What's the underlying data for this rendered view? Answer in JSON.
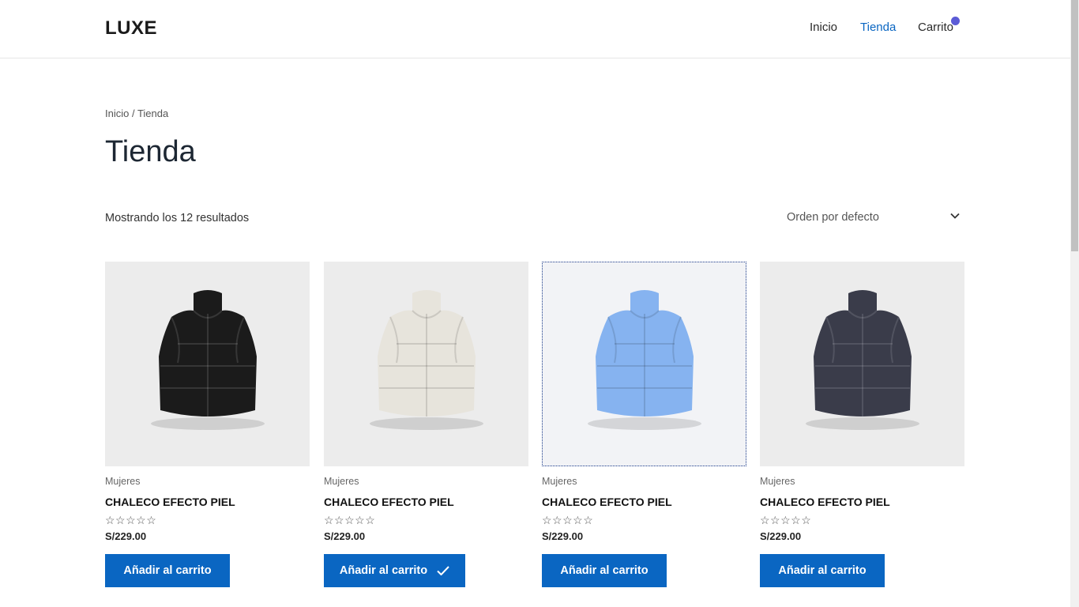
{
  "header": {
    "logo": "LUXE",
    "nav": [
      {
        "label": "Inicio",
        "active": false
      },
      {
        "label": "Tienda",
        "active": true
      },
      {
        "label": "Carrito",
        "active": false
      }
    ],
    "cart_badge_color": "#5b5bd6"
  },
  "breadcrumb": "Inicio / Tienda",
  "page_title": "Tienda",
  "result_count": "Mostrando los 12 resultados",
  "sort": {
    "selected": "Orden por defecto",
    "icon": "chevron-down-icon"
  },
  "colors": {
    "accent": "#0a66c2",
    "button_text": "#ffffff"
  },
  "products": [
    {
      "category": "Mujeres",
      "title": "CHALECO EFECTO PIEL",
      "rating_stars": "☆☆☆☆☆",
      "price": "S/229.00",
      "button": "Añadir al carrito",
      "vest_color": "#1b1b1b",
      "added": false
    },
    {
      "category": "Mujeres",
      "title": "CHALECO EFECTO PIEL",
      "rating_stars": "☆☆☆☆☆",
      "price": "S/229.00",
      "button": "Añadir al carrito",
      "vest_color": "#e7e4dc",
      "added": true
    },
    {
      "category": "Mujeres",
      "title": "CHALECO EFECTO PIEL",
      "rating_stars": "☆☆☆☆☆",
      "price": "S/229.00",
      "button": "Añadir al carrito",
      "vest_color": "#86b3f0",
      "added": false
    },
    {
      "category": "Mujeres",
      "title": "CHALECO EFECTO PIEL",
      "rating_stars": "☆☆☆☆☆",
      "price": "S/229.00",
      "button": "Añadir al carrito",
      "vest_color": "#3a3c4a",
      "added": false
    }
  ]
}
